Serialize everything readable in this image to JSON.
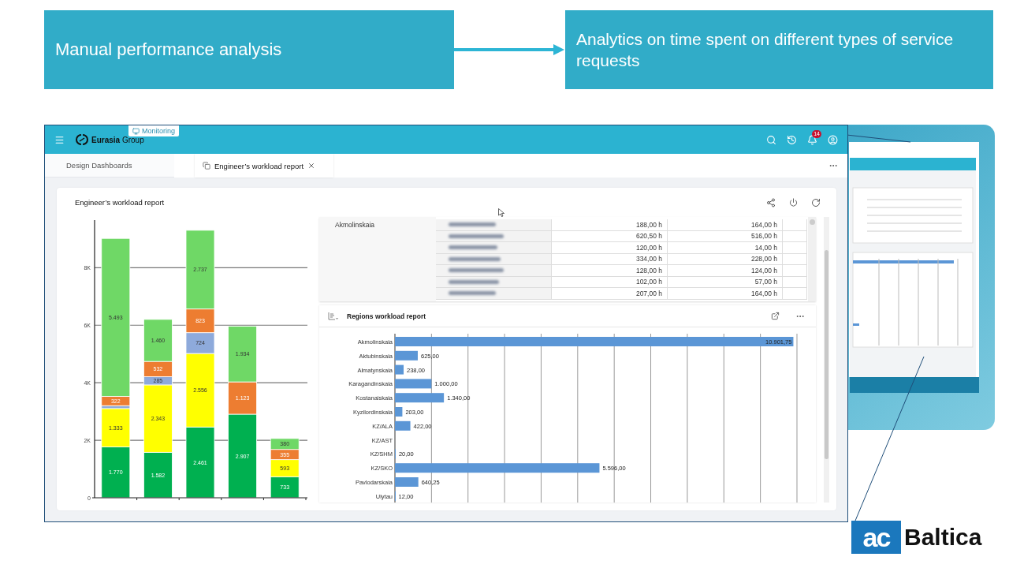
{
  "slide": {
    "source_box": "Manual performance analysis",
    "target_box": "Analytics on time spent on different types of service requests",
    "logo": {
      "mark": "ac",
      "name": "Baltica"
    }
  },
  "app": {
    "brand": {
      "name": "Eurasia",
      "suffix": "Group"
    },
    "section_tag": "Monitoring",
    "notifications": "14",
    "tabs": [
      {
        "label": "Design Dashboards",
        "selected": false,
        "closable": false
      },
      {
        "label": "Engineer’s workload report",
        "selected": true,
        "closable": true
      }
    ],
    "card": {
      "title": "Engineer’s workload report",
      "chart": {
        "chart_data": {
          "type": "bar",
          "stacked": true,
          "grid": true,
          "ylim": [
            0,
            9600
          ],
          "yticks": [
            {
              "value": 0,
              "label": "0"
            },
            {
              "value": 2000,
              "label": "2K"
            },
            {
              "value": 4000,
              "label": "4K"
            },
            {
              "value": 6000,
              "label": "6K"
            },
            {
              "value": 8000,
              "label": "8K"
            }
          ],
          "series": [
            {
              "color": "#00b050",
              "values": [
                1770,
                1582,
                2461,
                2907,
                733
              ],
              "value_labels": [
                "1.770",
                "1.582",
                "2.461",
                "2.907",
                "733"
              ]
            },
            {
              "color": "#ffff00",
              "values": [
                1333,
                2343,
                2556,
                null,
                593
              ],
              "value_labels": [
                "1.333",
                "2.343",
                "2.556",
                null,
                "593"
              ]
            },
            {
              "color": "#8eaadb",
              "values": [
                100,
                285,
                724,
                null,
                null
              ],
              "value_labels": [
                null,
                "285",
                "724",
                null,
                null
              ]
            },
            {
              "color": "#ed7d31",
              "values": [
                322,
                532,
                823,
                1123,
                355
              ],
              "value_labels": [
                "322",
                "532",
                "823",
                "1.123",
                "355"
              ]
            },
            {
              "color": "#6fd866",
              "values": [
                5493,
                1460,
                2737,
                1934,
                380
              ],
              "value_labels": [
                "5.493",
                "1.460",
                "2.737",
                "1.934",
                "380"
              ]
            }
          ]
        }
      },
      "table": {
        "group": "Akmolinskaia",
        "rows": [
          {
            "column_3": "188,00 h",
            "column_4": "164,00 h"
          },
          {
            "column_3": "620,50 h",
            "column_4": "516,00 h"
          },
          {
            "column_3": "120,00 h",
            "column_4": "14,00 h"
          },
          {
            "column_3": "334,00 h",
            "column_4": "228,00 h"
          },
          {
            "column_3": "128,00 h",
            "column_4": "124,00 h"
          },
          {
            "column_3": "102,00 h",
            "column_4": "57,00 h"
          },
          {
            "column_3": "207,00 h",
            "column_4": "164,00 h"
          }
        ]
      },
      "regions": {
        "chart_data": {
          "type": "bar",
          "orientation": "horizontal",
          "title": "Regions workload report",
          "xlim": [
            0,
            11000
          ],
          "categories": [
            "Akmolinskaia",
            "Aktubinskaia",
            "Almatynskaia",
            "Karagandinskaia",
            "Kostanaiskaia",
            "Kyzilordinskaia",
            "KZ/ALA",
            "KZ/AST",
            "KZ/SHM",
            "KZ/SKO",
            "Pavlodarskaia",
            "Ulytau"
          ],
          "values": [
            10901.75,
            625,
            238,
            1000,
            1340,
            203,
            422,
            null,
            20,
            5596,
            640.25,
            12
          ],
          "value_labels": [
            "10.901,75",
            "625,00",
            "238,00",
            "1.000,00",
            "1.340,00",
            "203,00",
            "422,00",
            null,
            "20,00",
            "5.596,00",
            "640,25",
            "12,00"
          ]
        }
      }
    }
  }
}
